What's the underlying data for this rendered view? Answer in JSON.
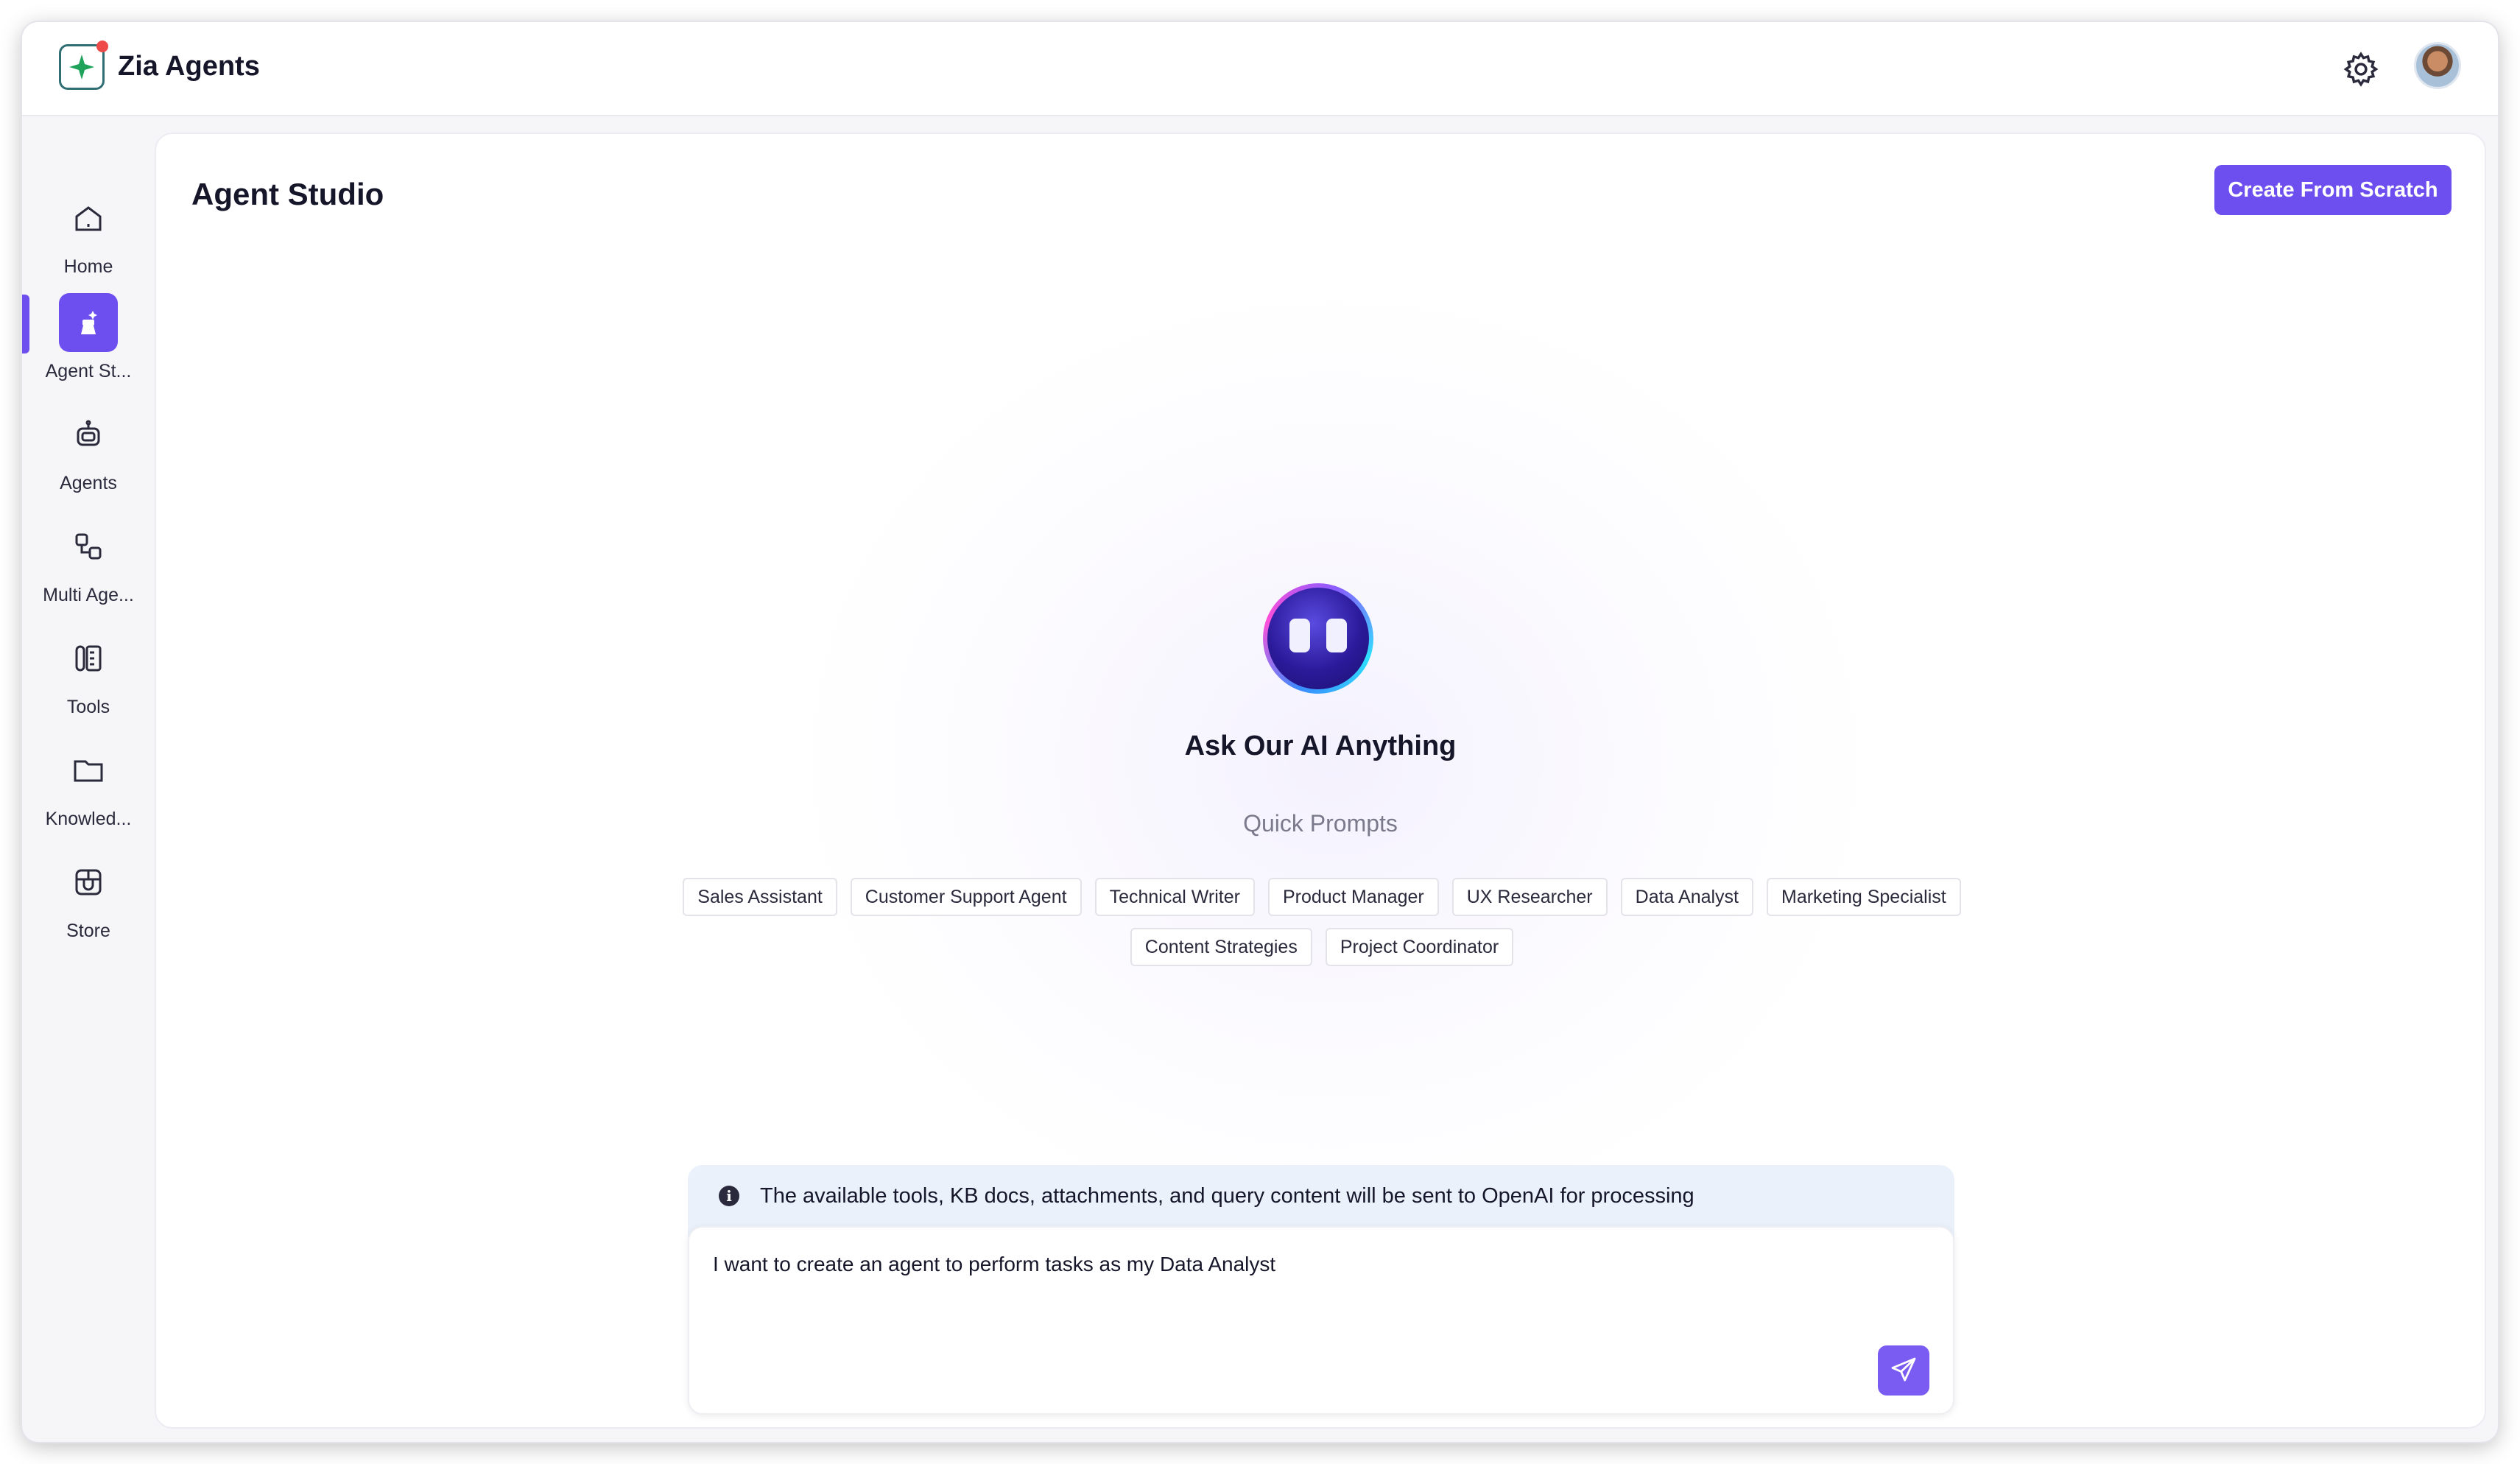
{
  "app": {
    "title": "Zia Agents",
    "logo_icon": "sparkle-logo-icon",
    "accent": "#6d4ff0"
  },
  "header": {
    "settings_icon": "gear-icon",
    "avatar_icon": "user-avatar"
  },
  "sidebar": {
    "items": [
      {
        "label": "Home",
        "icon": "home-icon"
      },
      {
        "label": "Agent St...",
        "icon": "agent-studio-icon",
        "active": true
      },
      {
        "label": "Agents",
        "icon": "robot-icon"
      },
      {
        "label": "Multi Age...",
        "icon": "multi-agent-icon"
      },
      {
        "label": "Tools",
        "icon": "tools-icon"
      },
      {
        "label": "Knowled...",
        "icon": "folder-icon"
      },
      {
        "label": "Store",
        "icon": "store-icon"
      }
    ]
  },
  "main": {
    "title": "Agent Studio",
    "create_button": "Create From Scratch",
    "ask_title": "Ask Our AI Anything",
    "quick_prompts_title": "Quick Prompts",
    "quick_prompts": [
      "Sales Assistant",
      "Customer Support Agent",
      "Technical Writer",
      "Product Manager",
      "UX Researcher",
      "Data Analyst",
      "Marketing Specialist",
      "Content Strategies",
      "Project Coordinator"
    ],
    "notice": "The available tools, KB docs, attachments, and query content will be sent to OpenAI for processing",
    "composer_text": "I want to create an agent to perform tasks as my Data Analyst",
    "send_icon": "send-icon"
  }
}
